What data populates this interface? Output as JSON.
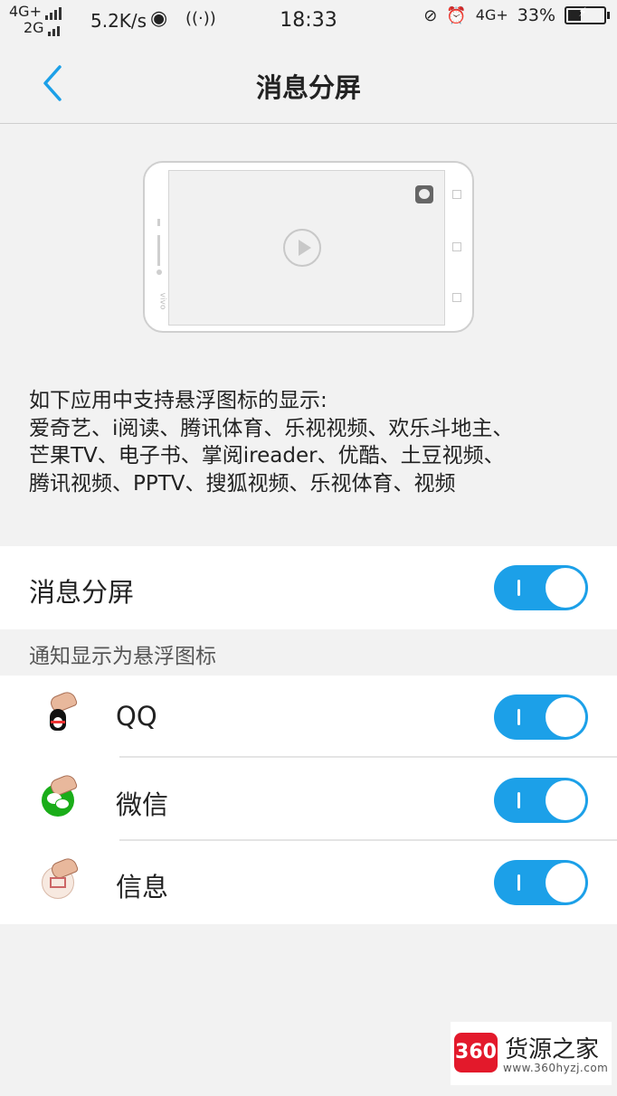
{
  "status_bar": {
    "network_top": "4G+",
    "network_bottom": "2G",
    "speed": "5.2K/s",
    "time": "18:33",
    "network_right": "4G+",
    "battery": "33%",
    "icons": [
      "signal-icon",
      "weibo-icon",
      "hotspot-icon",
      "mute-icon",
      "alarm-icon",
      "battery-charging-icon"
    ]
  },
  "header": {
    "title": "消息分屏",
    "back_icon": "chevron-left-icon",
    "accent_color": "#1ca0e8"
  },
  "description": {
    "heading": "如下应用中支持悬浮图标的显示:",
    "lines": [
      "爱奇艺、i阅读、腾讯体育、乐视视频、欢乐斗地主、",
      "芒果TV、电子书、掌阅ireader、优酷、土豆视频、",
      "腾讯视频、PPTV、搜狐视频、乐视体育、视频"
    ]
  },
  "master_setting": {
    "label": "消息分屏",
    "enabled": true
  },
  "section": {
    "header": "通知显示为悬浮图标"
  },
  "apps": [
    {
      "name": "QQ",
      "icon": "qq-icon",
      "enabled": true
    },
    {
      "name": "微信",
      "icon": "wechat-icon",
      "enabled": true
    },
    {
      "name": "信息",
      "icon": "messages-icon",
      "enabled": true
    }
  ],
  "watermark": {
    "badge": "360",
    "name": "货源之家",
    "url": "www.360hyzj.com"
  }
}
